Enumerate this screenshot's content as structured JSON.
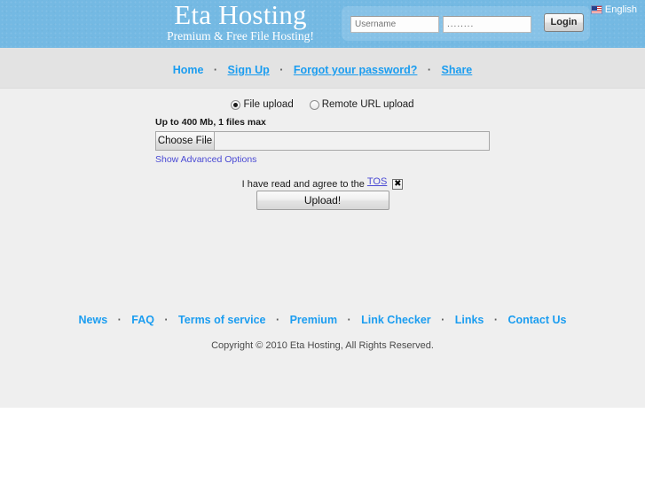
{
  "header": {
    "logo_title": "Eta Hosting",
    "logo_tagline": "Premium & Free File Hosting!",
    "brand_blue": "#74b9e3",
    "login": {
      "username_placeholder": "Username",
      "username_value": "",
      "password_value": "........",
      "login_button": "Login"
    },
    "language": {
      "icon": "us-flag-icon",
      "label": "English"
    }
  },
  "nav": {
    "separator": "·",
    "items": [
      {
        "label": "Home",
        "underlined": false
      },
      {
        "label": "Sign Up",
        "underlined": true
      },
      {
        "label": "Forgot your password?",
        "underlined": true
      },
      {
        "label": "Share",
        "underlined": true
      }
    ]
  },
  "main": {
    "upload_modes": [
      {
        "label": "File upload",
        "selected": true
      },
      {
        "label": "Remote URL upload",
        "selected": false
      }
    ],
    "limit_text": "Up to 400 Mb, 1 files max",
    "choose_file_label": "Choose File",
    "file_name_value": "",
    "advanced_options_label": "Show Advanced Options",
    "tos_text": "I have read and agree to the",
    "tos_link_label": "TOS",
    "tos_checked": true,
    "upload_button_label": "Upload!"
  },
  "footer": {
    "separator": "·",
    "links": [
      {
        "label": "News"
      },
      {
        "label": "FAQ"
      },
      {
        "label": "Terms of service"
      },
      {
        "label": "Premium"
      },
      {
        "label": "Link Checker"
      },
      {
        "label": "Links"
      },
      {
        "label": "Contact Us"
      }
    ],
    "copyright": "Copyright © 2010 Eta Hosting, All Rights Reserved."
  }
}
